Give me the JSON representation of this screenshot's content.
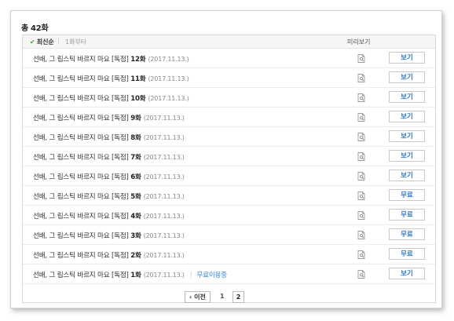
{
  "summary": {
    "label": "총",
    "count": "42화"
  },
  "list_header": {
    "sort_latest_icon": "✔",
    "sort_latest": "최신순",
    "separator": "|",
    "sort_first": "1화부터",
    "preview": "미리보기"
  },
  "episodes": [
    {
      "title": "선배, 그 립스틱 바르지 마요 [독점]",
      "ep": "12화",
      "date": "(2017.11.13.)",
      "note": "",
      "action": "보기"
    },
    {
      "title": "선배, 그 립스틱 바르지 마요 [독점]",
      "ep": "11화",
      "date": "(2017.11.13.)",
      "note": "",
      "action": "보기"
    },
    {
      "title": "선배, 그 립스틱 바르지 마요 [독점]",
      "ep": "10화",
      "date": "(2017.11.13.)",
      "note": "",
      "action": "보기"
    },
    {
      "title": "선배, 그 립스틱 바르지 마요 [독점]",
      "ep": "9화",
      "date": "(2017.11.13.)",
      "note": "",
      "action": "보기"
    },
    {
      "title": "선배, 그 립스틱 바르지 마요 [독점]",
      "ep": "8화",
      "date": "(2017.11.13.)",
      "note": "",
      "action": "보기"
    },
    {
      "title": "선배, 그 립스틱 바르지 마요 [독점]",
      "ep": "7화",
      "date": "(2017.11.13.)",
      "note": "",
      "action": "보기"
    },
    {
      "title": "선배, 그 립스틱 바르지 마요 [독점]",
      "ep": "6화",
      "date": "(2017.11.13.)",
      "note": "",
      "action": "보기"
    },
    {
      "title": "선배, 그 립스틱 바르지 마요 [독점]",
      "ep": "5화",
      "date": "(2017.11.13.)",
      "note": "",
      "action": "무료"
    },
    {
      "title": "선배, 그 립스틱 바르지 마요 [독점]",
      "ep": "4화",
      "date": "(2017.11.13.)",
      "note": "",
      "action": "무료"
    },
    {
      "title": "선배, 그 립스틱 바르지 마요 [독점]",
      "ep": "3화",
      "date": "(2017.11.13.)",
      "note": "",
      "action": "무료"
    },
    {
      "title": "선배, 그 립스틱 바르지 마요 [독점]",
      "ep": "2화",
      "date": "(2017.11.13.)",
      "note": "",
      "action": "무료"
    },
    {
      "title": "선배, 그 립스틱 바르지 마요 [독점]",
      "ep": "1화",
      "date": "(2017.11.13.)",
      "note": "무료이용중",
      "action": "보기"
    }
  ],
  "preview_icon": "preview-document-icon",
  "pagination": {
    "prev": "‹ 이전",
    "pages": [
      "1",
      "2"
    ],
    "current": "2"
  },
  "colors": {
    "check": "#45a81f",
    "action_text": "#2f77c8",
    "usage_text": "#3a86d6"
  }
}
